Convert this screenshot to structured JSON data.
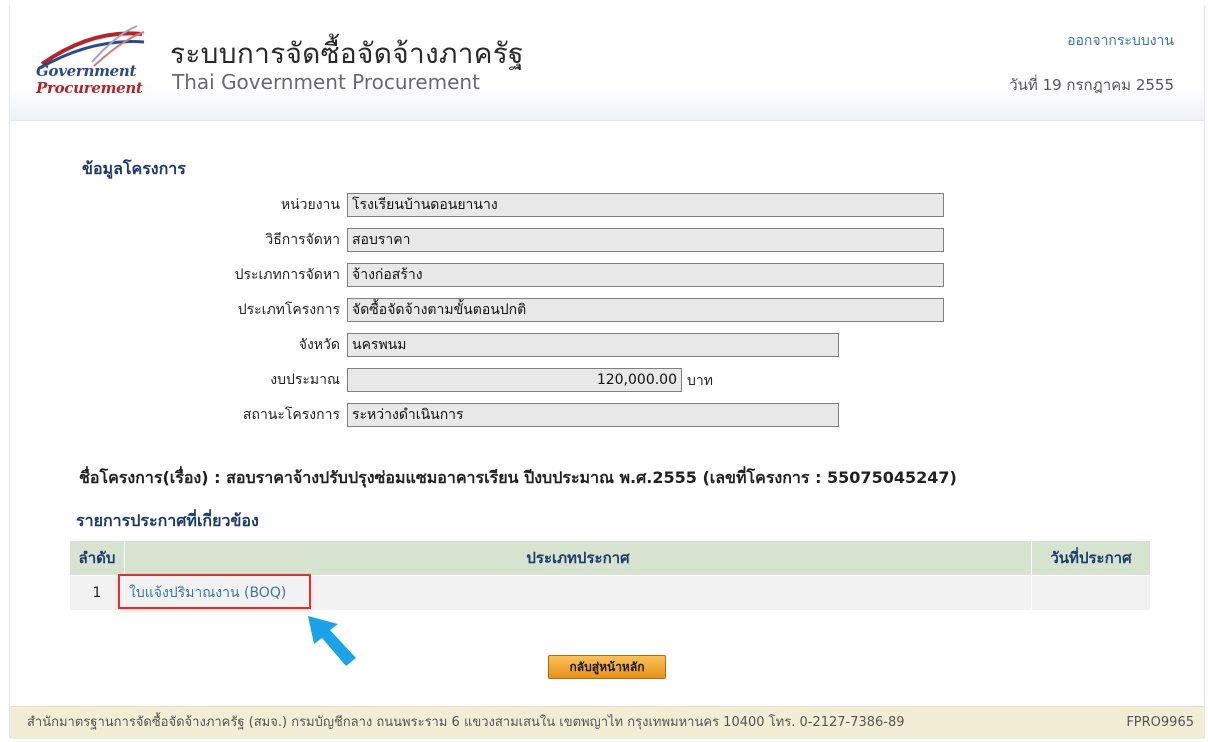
{
  "header": {
    "logo_line1": "Government",
    "logo_line2": "Procurement",
    "title_th": "ระบบการจัดซื้อจัดจ้างภาครัฐ",
    "title_en": "Thai Government Procurement",
    "logout": "ออกจากระบบงาน",
    "date": "วันที่ 19 กรกฎาคม 2555"
  },
  "project_info": {
    "section_title": "ข้อมูลโครงการ",
    "fields": [
      {
        "label": "หน่วยงาน",
        "value": "โรงเรียนบ้านดอนยานาง"
      },
      {
        "label": "วิธีการจัดหา",
        "value": "สอบราคา"
      },
      {
        "label": "ประเภทการจัดหา",
        "value": "จ้างก่อสร้าง"
      },
      {
        "label": "ประเภทโครงการ",
        "value": "จัดซื้อจัดจ้างตามขั้นตอนปกติ"
      },
      {
        "label": "จังหวัด",
        "value": "นครพนม"
      },
      {
        "label": "งบประมาณ",
        "value": "120,000.00",
        "unit": "บาท"
      },
      {
        "label": "สถานะโครงการ",
        "value": "ระหว่างดำเนินการ"
      }
    ]
  },
  "project_name_line": "ชื่อโครงการ(เรื่อง) : สอบราคาจ้างปรับปรุงซ่อมแซมอาคารเรียน ปีงบประมาณ พ.ศ.2555 (เลขที่โครงการ : 55075045247)",
  "announcements": {
    "section_title": "รายการประกาศที่เกี่ยวข้อง",
    "columns": [
      "ลำดับ",
      "ประเภทประกาศ",
      "วันที่ประกาศ"
    ],
    "rows": [
      {
        "index": "1",
        "type": "ใบแจ้งปริมาณงาน (BOQ)",
        "date": ""
      }
    ]
  },
  "back_button": "กลับสู่หน้าหลัก",
  "footer": {
    "text": "สำนักมาตรฐานการจัดซื้อจัดจ้างภาครัฐ (สมจ.) กรมบัญชีกลาง ถนนพระราม 6 แขวงสามเสนใน เขตพญาไท กรุงเทพมหานคร 10400 โทร. 0-2127-7386-89",
    "code": "FPRO9965"
  },
  "colors": {
    "accent_link": "#3b76b0",
    "table_header": "#d6e3cf",
    "highlight_box": "#e0312e",
    "pointer_arrow": "#1aa3e8",
    "button": "#f0a63a"
  }
}
